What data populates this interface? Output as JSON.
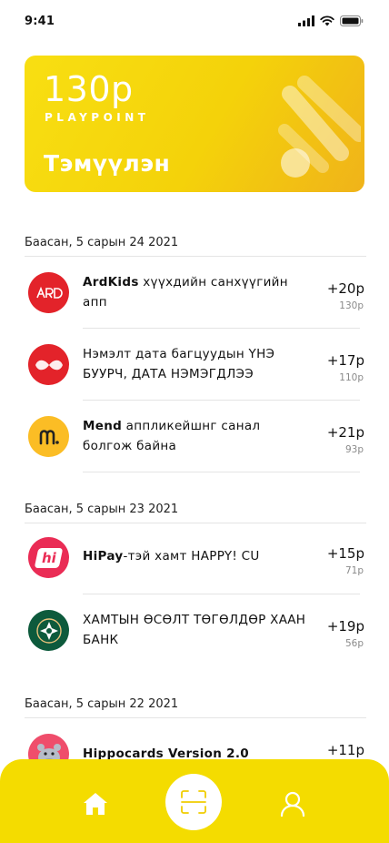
{
  "status_bar": {
    "time": "9:41"
  },
  "card": {
    "amount": "130р",
    "caption": "PLAYPOINT",
    "name": "Тэмүүлэн",
    "color": "#f4d80a"
  },
  "groups": [
    {
      "date": "Баасан, 5 сарын 24 2021",
      "items": [
        {
          "title_brand": "ArdKids",
          "title_text": " хүүхдийн санхүүгийн апп",
          "points": "+20р",
          "total": "130р",
          "icon": "ardkids-logo-icon",
          "color": "#e3232a"
        },
        {
          "title_brand": "",
          "title_text": "Нэмэлт дата багцуудын ҮНЭ БУУРЧ, ДАТА НЭМЭГДЛЭЭ",
          "points": "+17р",
          "total": "110р",
          "icon": "unitel-logo-icon",
          "color": "#e3232a"
        },
        {
          "title_brand": "Mend",
          "title_text": " аппликейшнг санал болгож байна",
          "points": "+21р",
          "total": "93р",
          "icon": "mend-logo-icon",
          "color": "#fbbd25"
        }
      ]
    },
    {
      "date": "Баасан, 5 сарын 23 2021",
      "items": [
        {
          "title_brand": "HiPay",
          "title_text": "-тэй хамт HAPPY! CU",
          "points": "+15р",
          "total": "71р",
          "icon": "hipay-logo-icon",
          "color": "#ea2c55"
        },
        {
          "title_brand": "",
          "title_text": "ХАМТЫН ӨСӨЛТ ТӨГӨЛДӨР ХААН БАНК",
          "points": "+19р",
          "total": "56р",
          "icon": "khan-bank-logo-icon",
          "color": "#0d5a3c"
        }
      ]
    },
    {
      "date": "Баасан, 5 сарын 22 2021",
      "items": [
        {
          "title_brand": "Hippocards Version 2.0",
          "title_text": "",
          "points": "+11р",
          "total": "",
          "icon": "hippocards-logo-icon",
          "color": "#ef4d6b"
        }
      ]
    }
  ],
  "nav": {
    "items": [
      "home-icon",
      "scan-icon",
      "profile-icon"
    ],
    "color": "#f4dc00"
  }
}
